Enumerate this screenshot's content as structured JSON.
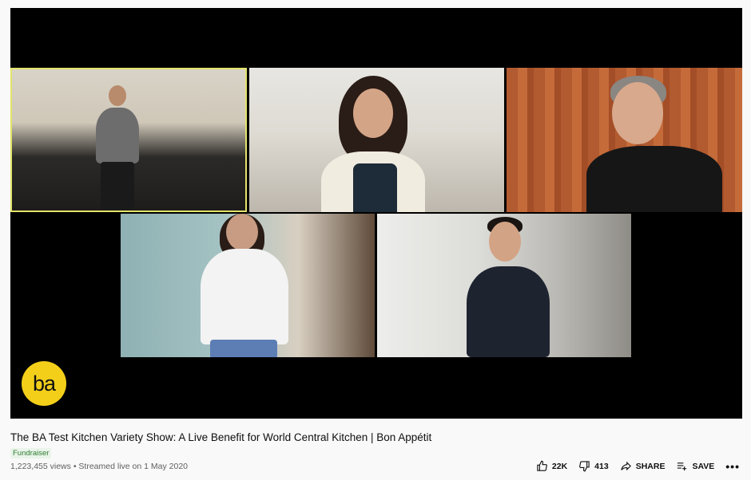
{
  "video": {
    "logo_text": "ba",
    "participants": [
      "tile-1",
      "tile-2",
      "tile-3",
      "tile-4",
      "tile-5"
    ]
  },
  "info": {
    "title": "The BA Test Kitchen Variety Show: A Live Benefit for World Central Kitchen | Bon Appétit",
    "badge": "Fundraiser",
    "views": "1,223,455 views",
    "separator": "•",
    "streamed": "Streamed live on 1 May 2020"
  },
  "actions": {
    "like_count": "22K",
    "dislike_count": "413",
    "share_label": "SHARE",
    "save_label": "SAVE",
    "more_label": "•••"
  },
  "colors": {
    "logo": "#f4cf1a",
    "active_outline": "#e3e36a",
    "badge_text": "#2e7d32"
  }
}
